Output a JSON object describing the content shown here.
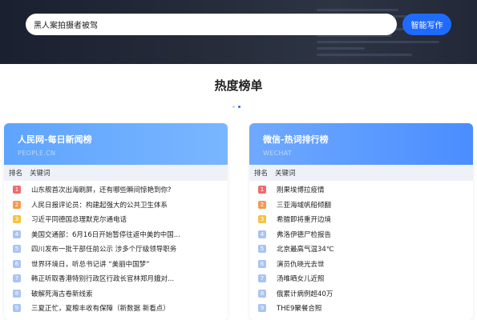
{
  "search": {
    "value": "黑人案拍摄者被驾"
  },
  "write_button": "智能写作",
  "section_title": "热度榜单",
  "colors": {
    "rank1": "#f06a6a",
    "rank2": "#f39a4f",
    "rank3": "#f5c242",
    "rank_other": "#a9c3f4"
  },
  "boards": [
    {
      "title": "人民网-每日新闻榜",
      "subtitle": "PEOPLE.CN",
      "col_rank": "排名",
      "col_keyword": "关键词",
      "items": [
        {
          "rank": "1",
          "text": "山东舰首次出海刷屏，还有哪些瞬间惊艳到你?"
        },
        {
          "rank": "2",
          "text": "人民日报评论员：构建起强大的公共卫生体系"
        },
        {
          "rank": "3",
          "text": "习近平同德国总理默克尔通电话"
        },
        {
          "rank": "4",
          "text": "美国交通部：6月16日开始暂停往返中美的中国..."
        },
        {
          "rank": "5",
          "text": "四川发布一批干部任前公示 涉多个厅级领导职务"
        },
        {
          "rank": "6",
          "text": "世界环境日，听总书记讲 “美丽中国梦”"
        },
        {
          "rank": "7",
          "text": "韩正听取香港特别行政区行政长官林郑月娥对..."
        },
        {
          "rank": "8",
          "text": "破解死海古卷新线索"
        },
        {
          "rank": "9",
          "text": "三夏正忙，夏粮丰收有保障（新数据 新看点）"
        }
      ]
    },
    {
      "title": "微信-热词排行榜",
      "subtitle": "WECHAT",
      "col_rank": "排名",
      "col_keyword": "关键词",
      "items": [
        {
          "rank": "1",
          "text": "刚果埃博拉疫情"
        },
        {
          "rank": "2",
          "text": "三亚海域帆船倾翻"
        },
        {
          "rank": "3",
          "text": "希腊即将重开边境"
        },
        {
          "rank": "4",
          "text": "弗洛伊德尸检报告"
        },
        {
          "rank": "5",
          "text": "北京最高气温34℃"
        },
        {
          "rank": "6",
          "text": "演员仇晓光去世"
        },
        {
          "rank": "7",
          "text": "汤唯晒女儿近照"
        },
        {
          "rank": "8",
          "text": "俄累计病例超40万"
        },
        {
          "rank": "9",
          "text": "THE9聚餐合照"
        }
      ]
    }
  ]
}
